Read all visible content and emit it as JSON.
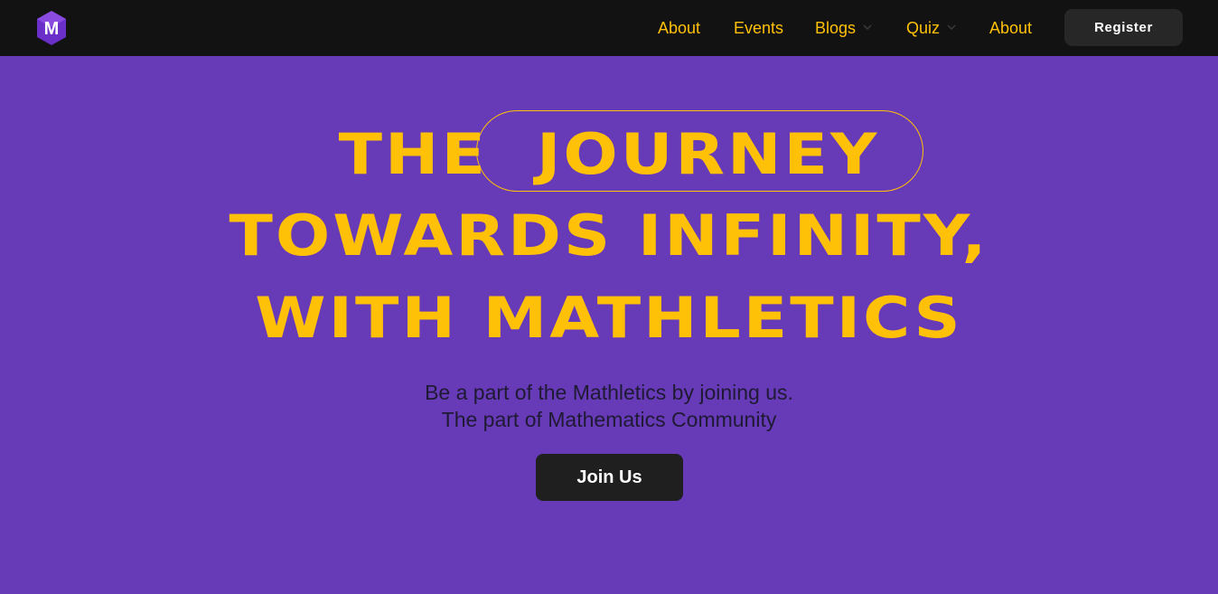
{
  "nav": {
    "logo_icon": "mathletics-hexagon-logo",
    "links": [
      {
        "label": "About"
      },
      {
        "label": "Events"
      },
      {
        "label": "Blogs",
        "has_dropdown": true
      },
      {
        "label": "Quiz",
        "has_dropdown": true
      },
      {
        "label": "About"
      }
    ],
    "register_label": "Register"
  },
  "hero": {
    "line1_pre": "THE",
    "line1_pill": "JOURNEY",
    "line2": "TOWARDS INFINITY,",
    "line3": "WITH MATHLETICS",
    "subtitle1": "Be a part of the Mathletics by joining us.",
    "subtitle2": "The part of Mathematics Community",
    "cta_label": "Join Us"
  },
  "colors": {
    "background": "#673ab7",
    "navbar": "#121212",
    "accent": "#ffc107",
    "button": "#1f1f1f"
  }
}
